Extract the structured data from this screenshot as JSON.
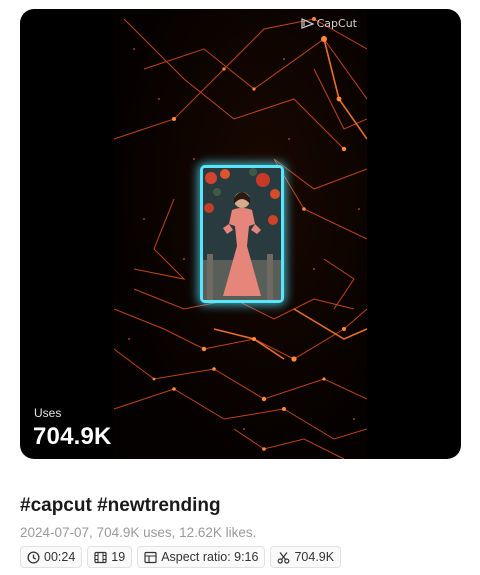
{
  "card": {
    "watermark": "CapCut",
    "uses_label": "Uses",
    "uses_value": "704.9K"
  },
  "template": {
    "title": "#capcut #newtrending",
    "meta": "2024-07-07, 704.9K uses, 12.62K likes."
  },
  "chips": {
    "duration": "00:24",
    "clips": "19",
    "aspect": "Aspect ratio: 9:16",
    "uses": "704.9K"
  },
  "icons": {
    "duration": "clock-icon",
    "clips": "film-icon",
    "aspect": "aspect-ratio-icon",
    "uses": "scissors-icon",
    "watermark": "capcut-logo-icon"
  },
  "colors": {
    "frame_glow": "#58e6ff",
    "network_lines": "#ff5a1a",
    "title_text": "#1a1a1a",
    "meta_text": "#9a9a9a"
  }
}
